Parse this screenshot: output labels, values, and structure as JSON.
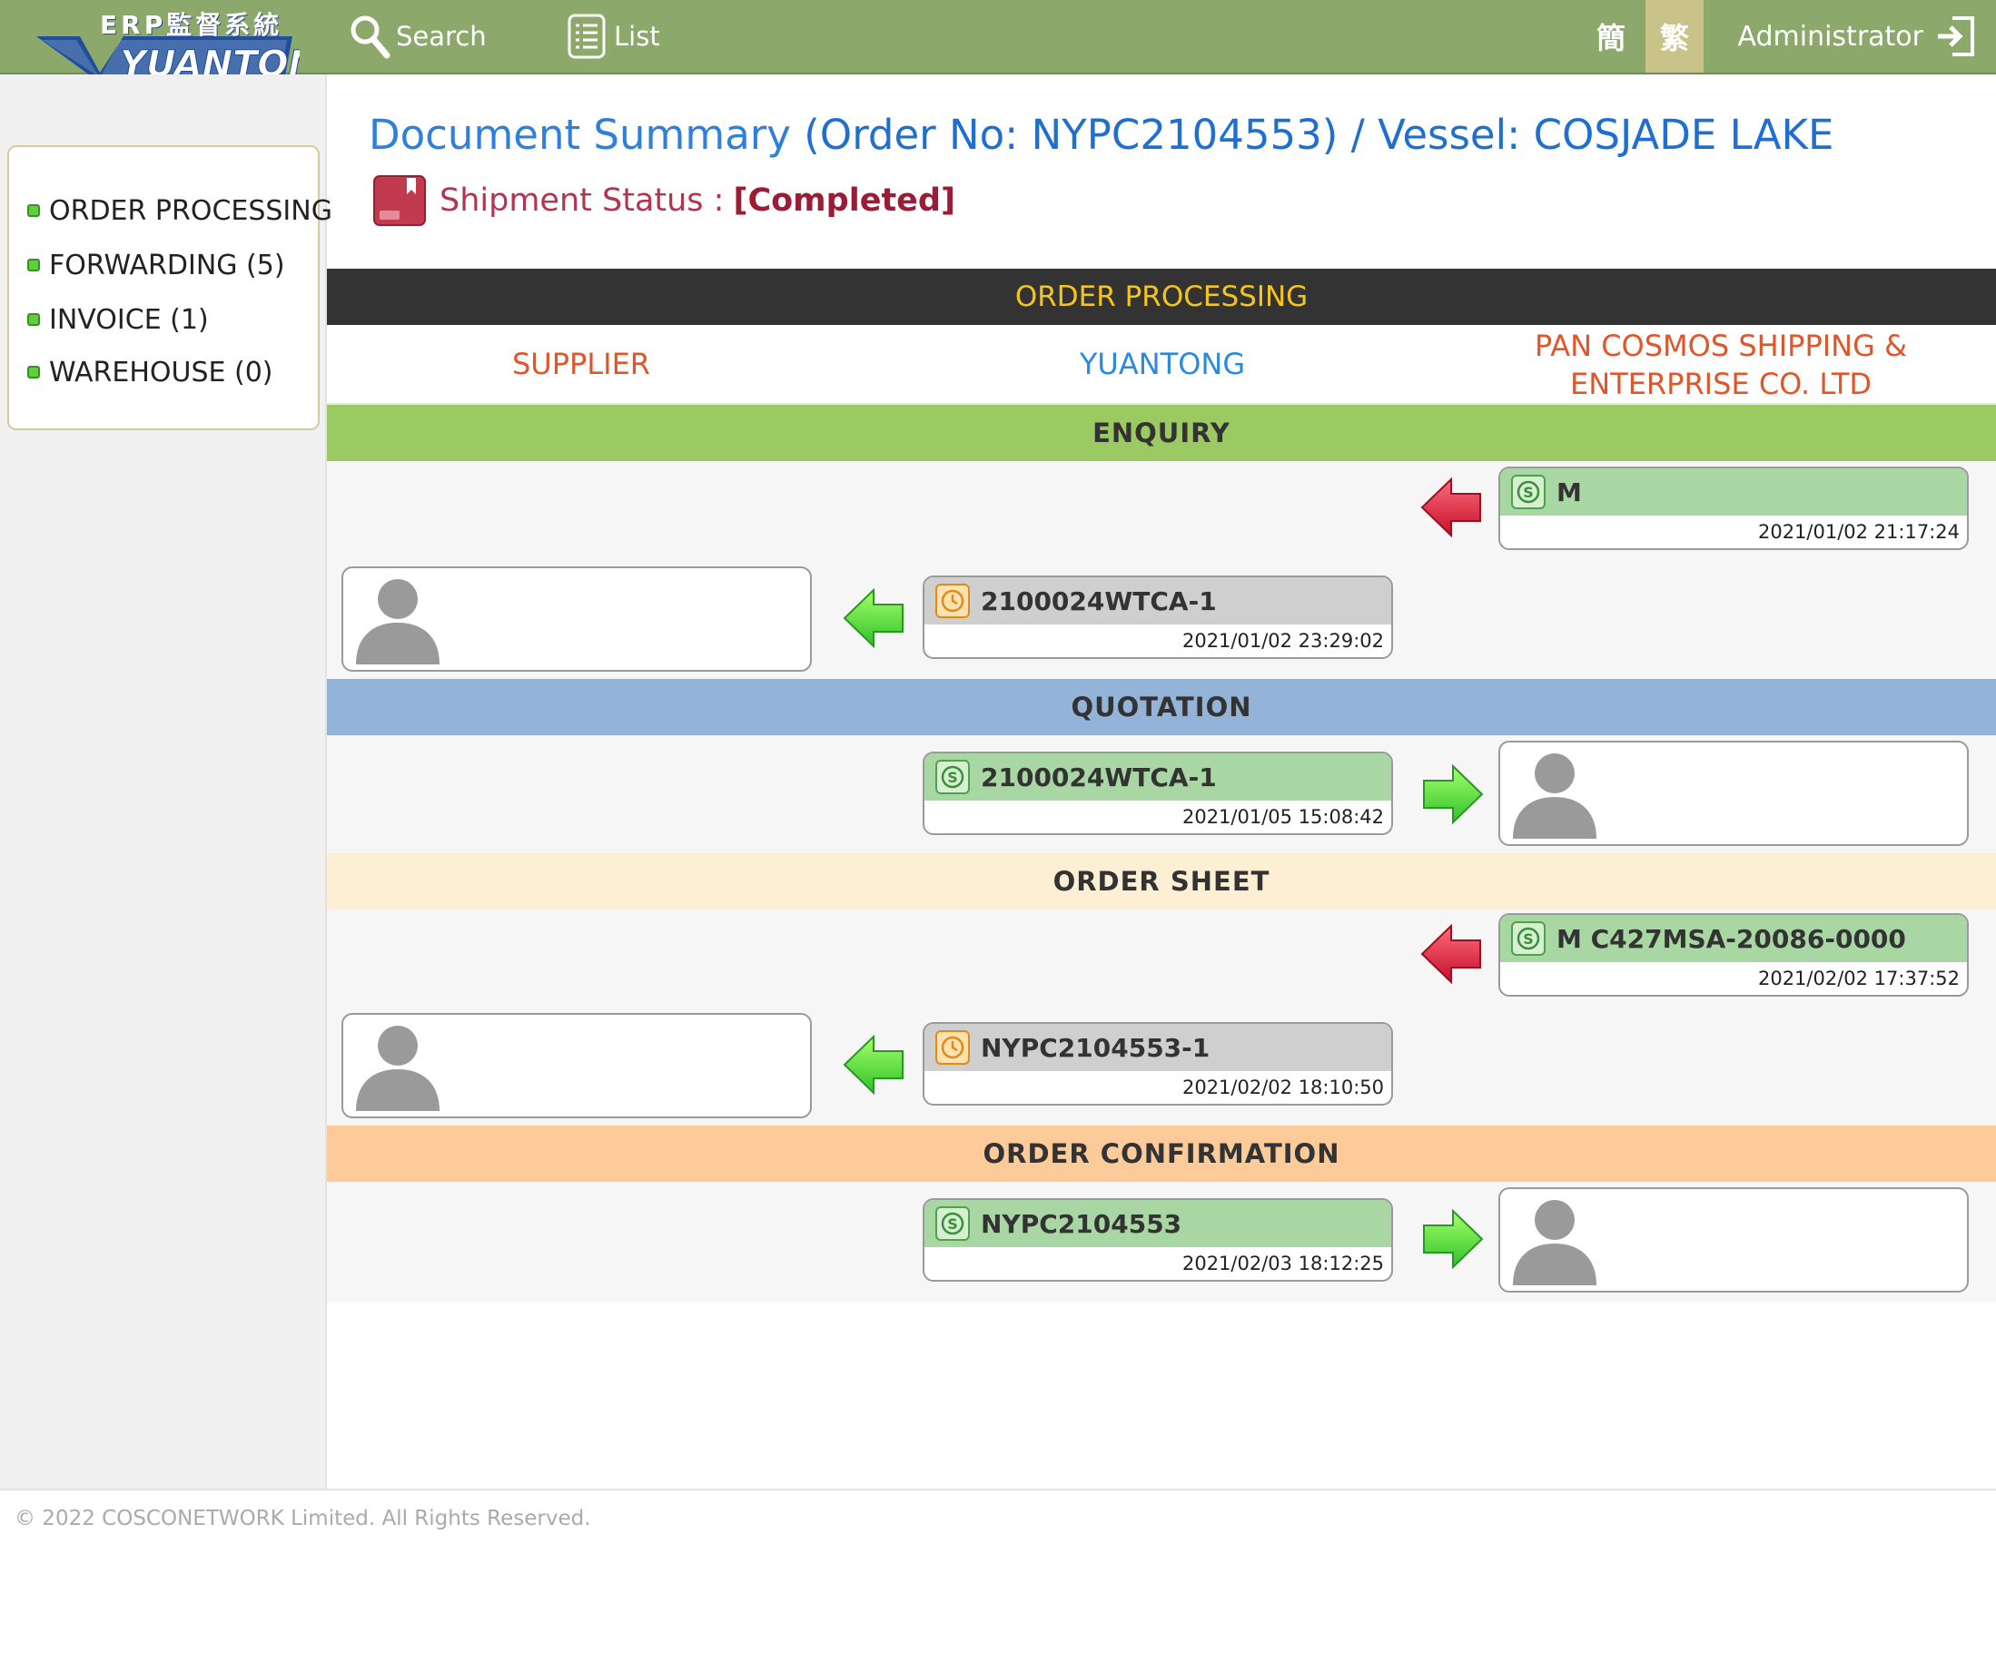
{
  "logo": {
    "cn_text": "ERP監督系統",
    "brand": "YUANTONG"
  },
  "nav": {
    "search_label": "Search",
    "list_label": "List"
  },
  "lang": {
    "simplified": "簡",
    "traditional": "繁"
  },
  "user": {
    "name": "Administrator"
  },
  "sidebar": {
    "items": [
      {
        "label": "ORDER PROCESSING"
      },
      {
        "label": "FORWARDING (5)"
      },
      {
        "label": "INVOICE (1)"
      },
      {
        "label": "WAREHOUSE (0)"
      }
    ]
  },
  "header": {
    "title_prefix": "Document Summary",
    "title_main": "(Order No: NYPC2104553) / Vessel: COSJADE LAKE",
    "status_label": "Shipment Status :",
    "status_value": "[Completed]"
  },
  "grid": {
    "band_title": "ORDER PROCESSING",
    "parties": {
      "supplier": "SUPPLIER",
      "yuantong": "YUANTONG",
      "customer_line1": "PAN COSMOS SHIPPING &",
      "customer_line2": "ENTERPRISE CO. LTD"
    },
    "sections": {
      "enquiry": "ENQUIRY",
      "quotation": "QUOTATION",
      "order_sheet": "ORDER SHEET",
      "order_confirmation": "ORDER CONFIRMATION"
    },
    "cards": {
      "enquiry_customer": {
        "title": "M",
        "time": "2021/01/02 21:17:24"
      },
      "enquiry_yuantong": {
        "title": "2100024WTCA-1",
        "time": "2021/01/02 23:29:02"
      },
      "quotation_yuantong": {
        "title": "2100024WTCA-1",
        "time": "2021/01/05 15:08:42"
      },
      "ordersheet_customer": {
        "title": "M C427MSA-20086-0000",
        "time": "2021/02/02 17:37:52"
      },
      "ordersheet_yuantong": {
        "title": "NYPC2104553-1",
        "time": "2021/02/02 18:10:50"
      },
      "confirmation_yuantong": {
        "title": "NYPC2104553",
        "time": "2021/02/03 18:12:25"
      }
    }
  },
  "colors": {
    "topbar": "#8ca86b",
    "enquiry_band": "#9bc962",
    "quotation_band": "#93b3d9",
    "order_sheet_band": "#fdefd4",
    "confirmation_band": "#fdcb9a",
    "supplier_text": "#e0562a",
    "yuantong_text": "#2a8ae0",
    "customer_text": "#e0562a"
  },
  "footer": {
    "copyright": "© 2022 COSCONETWORK Limited. All Rights Reserved."
  }
}
